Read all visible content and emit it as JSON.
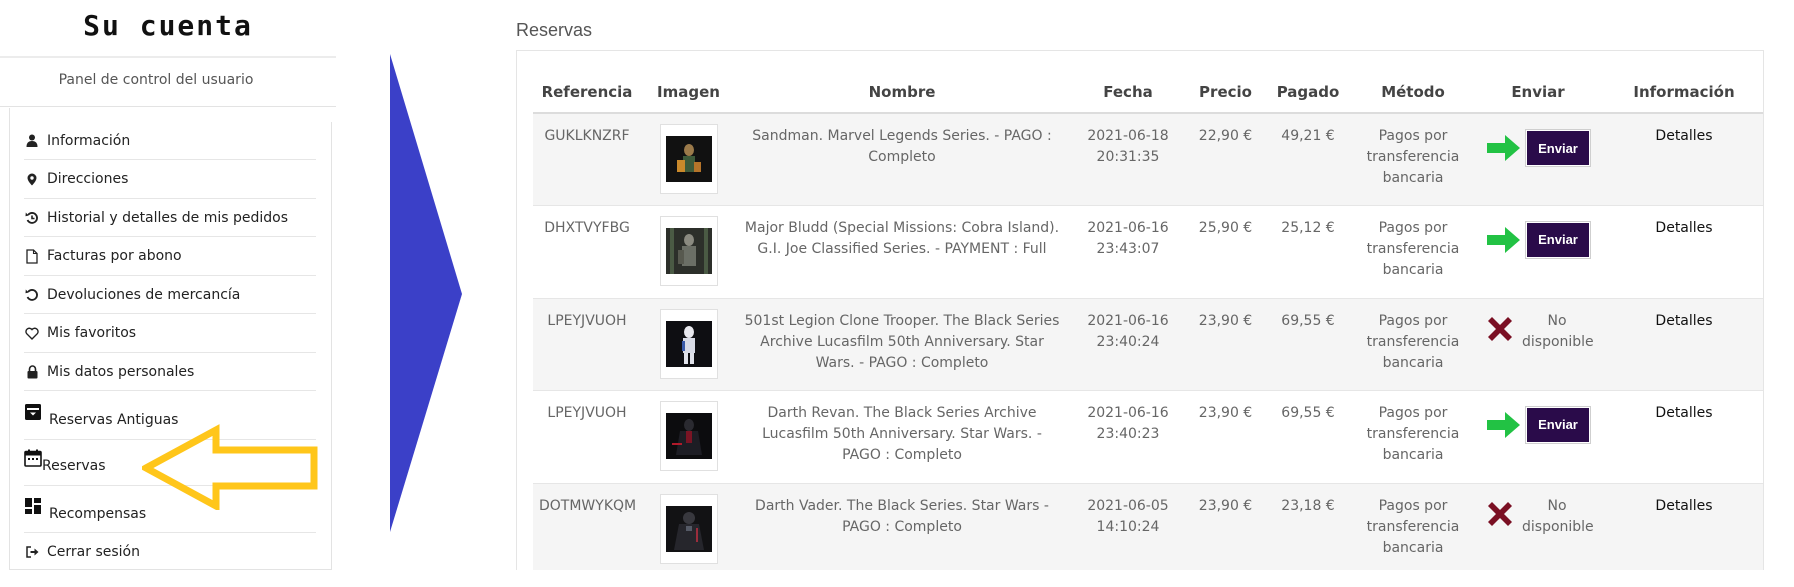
{
  "sidebar": {
    "title": "Su cuenta",
    "subtitle": "Panel de control del usuario",
    "items": [
      {
        "label": "Información",
        "icon": "user-icon"
      },
      {
        "label": "Direcciones",
        "icon": "map-pin-icon"
      },
      {
        "label": "Historial y detalles de mis pedidos",
        "icon": "history-icon"
      },
      {
        "label": "Facturas por abono",
        "icon": "document-icon"
      },
      {
        "label": "Devoluciones de mercancía",
        "icon": "return-icon"
      },
      {
        "label": "Mis favoritos",
        "icon": "heart-icon"
      },
      {
        "label": "Mis datos personales",
        "icon": "lock-icon"
      },
      {
        "label": "Reservas Antiguas",
        "icon": "archive-box-icon"
      },
      {
        "label": "Reservas",
        "icon": "calendar-icon"
      },
      {
        "label": "Recompensas",
        "icon": "dashboard-icon"
      },
      {
        "label": "Cerrar sesión",
        "icon": "sign-out-icon"
      }
    ]
  },
  "main": {
    "title": "Reservas",
    "columns": [
      "Referencia",
      "Imagen",
      "Nombre",
      "Fecha",
      "Precio",
      "Pagado",
      "Método",
      "Enviar",
      "Información"
    ],
    "rows": [
      {
        "ref": "GUKLKNZRF",
        "name": "Sandman. Marvel Legends Series. - PAGO : Completo",
        "date": "2021-06-18",
        "time": "20:31:35",
        "price": "22,90 €",
        "paid": "49,21 €",
        "method": "Pagos por transferencia bancaria",
        "send": "Enviar",
        "info": "Detalles",
        "available": true
      },
      {
        "ref": "DHXTVYFBG",
        "name": "Major Bludd (Special Missions: Cobra Island). G.I. Joe Classified Series. - PAYMENT : Full",
        "date": "2021-06-16",
        "time": "23:43:07",
        "price": "25,90 €",
        "paid": "25,12 €",
        "method": "Pagos por transferencia bancaria",
        "send": "Enviar",
        "info": "Detalles",
        "available": true
      },
      {
        "ref": "LPEYJVUOH",
        "name": "501st Legion Clone Trooper. The Black Series Archive Lucasfilm 50th Anniversary. Star Wars. - PAGO : Completo",
        "date": "2021-06-16",
        "time": "23:40:24",
        "price": "23,90 €",
        "paid": "69,55 €",
        "method": "Pagos por transferencia bancaria",
        "send": "No disponible",
        "info": "Detalles",
        "available": false
      },
      {
        "ref": "LPEYJVUOH",
        "name": "Darth Revan. The Black Series Archive Lucasfilm 50th Anniversary. Star Wars. - PAGO : Completo",
        "date": "2021-06-16",
        "time": "23:40:23",
        "price": "23,90 €",
        "paid": "69,55 €",
        "method": "Pagos por transferencia bancaria",
        "send": "Enviar",
        "info": "Detalles",
        "available": true
      },
      {
        "ref": "DOTMWYKQM",
        "name": "Darth Vader. The Black Series. Star Wars - PAGO : Completo",
        "date": "2021-06-05",
        "time": "14:10:24",
        "price": "23,90 €",
        "paid": "23,18 €",
        "method": "Pagos por transferencia bancaria",
        "send": "No disponible",
        "info": "Detalles",
        "available": false
      }
    ]
  },
  "colors": {
    "send_button": "#2a0b4a",
    "green_arrow": "#22c244",
    "red_x": "#7a0f23",
    "blue_arrow": "#3b40c8",
    "yellow_arrow": "#ffc61a"
  }
}
